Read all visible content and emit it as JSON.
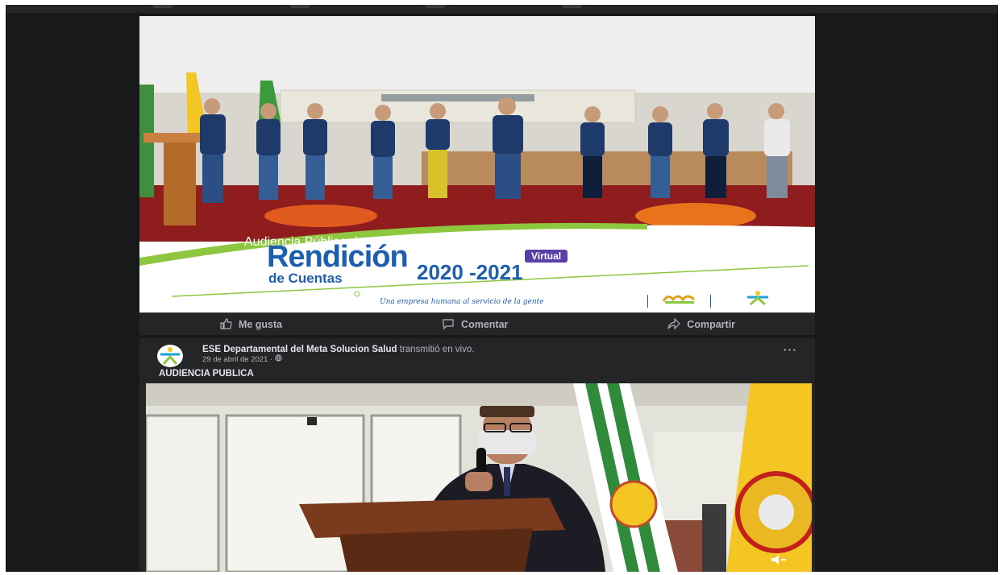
{
  "post1": {
    "banner": {
      "line1": "Audiencia Pública de",
      "line2": "Rendición",
      "badge": "Virtual",
      "line3": "de Cuentas",
      "years": "2020 -2021",
      "slogan": "Una empresa humana al servicio de la gente"
    },
    "actions": {
      "like": "Me gusta",
      "comment": "Comentar",
      "share": "Compartir"
    }
  },
  "post2": {
    "author": "ESE Departamental del Meta Solucion Salud",
    "action": " transmitió en vivo.",
    "date": "29 de abril de 2021 · ",
    "more": "···",
    "text": "AUDIENCIA PUBLICA"
  },
  "colors": {
    "background": "#18191a",
    "card": "#242526",
    "text_primary": "#e4e6eb",
    "text_secondary": "#b0b3b8",
    "banner_blue": "#1d5fae",
    "banner_green": "#8dc63f"
  },
  "icons": [
    "like-icon",
    "comment-icon",
    "share-icon",
    "globe-icon",
    "volume-icon"
  ]
}
